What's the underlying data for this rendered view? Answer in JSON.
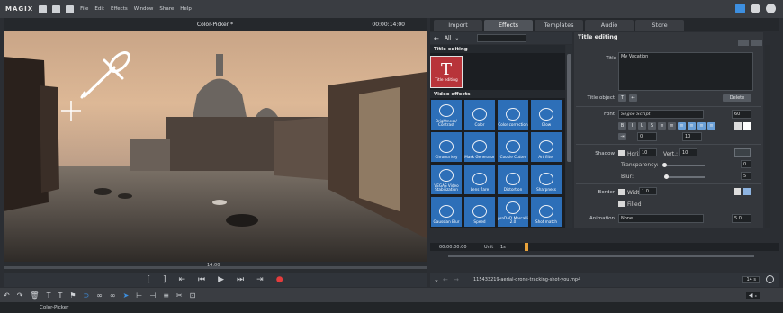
{
  "app": {
    "logo": "MAGIX",
    "menu": [
      "File",
      "Edit",
      "Effects",
      "Window",
      "Share",
      "Help"
    ]
  },
  "preview": {
    "title": "Color-Picker *",
    "timecode": "00:00:14:00",
    "scrub_label": "14:00"
  },
  "tabs": [
    "Import",
    "Effects",
    "Templates",
    "Audio",
    "Store"
  ],
  "library": {
    "filter": "All",
    "title_section": "Title editing",
    "title_tile": "Title editing",
    "video_section": "Video effects",
    "tiles": [
      "Brightness/ Contrast",
      "Color",
      "Color correction",
      "Glow",
      "Chroma key",
      "Mask Generator",
      "Cookie Cutter",
      "Art filter",
      "VEGAS Video Stabilization",
      "Lens flare",
      "Distortion",
      "Sharpness",
      "Gaussian Blur",
      "Speed",
      "proDAD Mercalli 2.0",
      "Shot match"
    ]
  },
  "props": {
    "header": "Title editing",
    "title_label": "Title",
    "title_value": "My Vacation",
    "title_object_label": "Title object",
    "delete_label": "Delete",
    "font_label": "Font",
    "font_value": "Segoe Script",
    "font_size": "60",
    "av_value": "0",
    "font_spacing": "10",
    "shadow_label": "Shadow",
    "horiz_label": "Horiz.:",
    "horiz_value": "10",
    "vert_label": "Vert.:",
    "vert_value": "10",
    "transparency_label": "Transparency:",
    "transparency_value": "0",
    "blur_label": "Blur:",
    "blur_value": "5",
    "border_label": "Border",
    "width_label": "Width:",
    "width_value": "1.0",
    "filled_label": "Filled",
    "animation_label": "Animation",
    "animation_value": "None",
    "animation_speed": "5.0"
  },
  "timeline": {
    "time": "00:00:00:00",
    "unit": "Unit",
    "unit_value": "1s"
  },
  "media": {
    "filename": "115433219-aerial-drone-tracking-shot-you.mp4",
    "zoom": "14 s"
  },
  "status": {
    "project": "Color-Picker"
  },
  "colors": {
    "accent": "#2d6fb8",
    "title_tile": "#b8343a",
    "record": "#e43c3c"
  }
}
